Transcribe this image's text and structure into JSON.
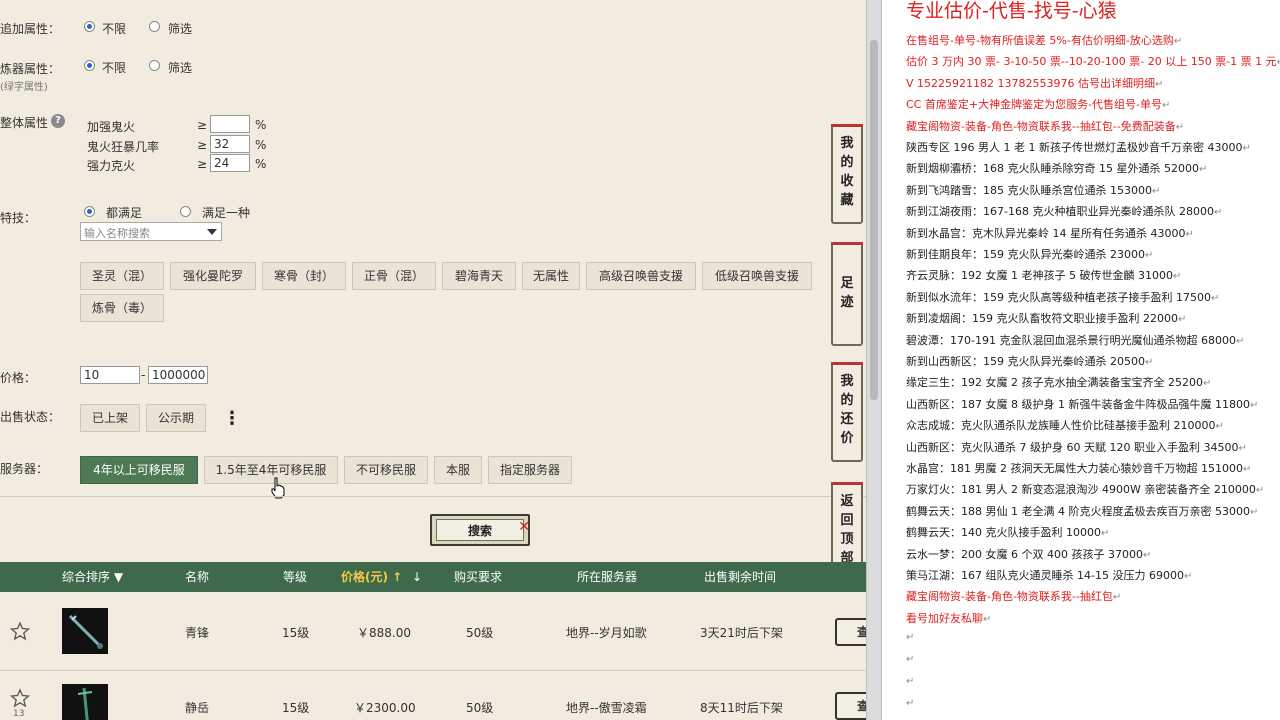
{
  "filters": {
    "extra_attr": {
      "label": "追加属性：",
      "opt1": "不限",
      "opt2": "筛选"
    },
    "forge_attr": {
      "label": "炼器属性：",
      "sub": "(绿字属性)",
      "opt1": "不限",
      "opt2": "筛选"
    },
    "overall": {
      "label": "整体属性",
      "rows": [
        {
          "name": "加强鬼火",
          "op": "≥",
          "value": "",
          "unit": "%"
        },
        {
          "name": "鬼火狂暴几率",
          "op": "≥",
          "value": "32",
          "unit": "%"
        },
        {
          "name": "强力克火",
          "op": "≥",
          "value": "24",
          "unit": "%"
        }
      ]
    },
    "skills": {
      "label": "特技：",
      "opt1": "都满足",
      "opt2": "满足一种",
      "search_placeholder": "输入名称搜索",
      "tags": [
        "圣灵（混）",
        "强化曼陀罗",
        "寒骨（封）",
        "正骨（混）",
        "碧海青天",
        "无属性",
        "高级召唤兽支援",
        "低级召唤兽支援",
        "炼骨（毒）"
      ]
    },
    "price": {
      "label": "价格：",
      "min": "10",
      "sep": "-",
      "max": "1000000"
    },
    "status": {
      "label": "出售状态：",
      "opt1": "已上架",
      "opt2": "公示期",
      "more": "⋮"
    },
    "server": {
      "label": "服务器：",
      "options": [
        "4年以上可移民服",
        "1.5年至4年可移民服",
        "不可移民服",
        "本服",
        "指定服务器"
      ]
    }
  },
  "search_button": "搜索",
  "side_buttons": {
    "fav": "我的收藏",
    "foot": "足迹",
    "bargain": "我的还价",
    "top": "返回顶部"
  },
  "table": {
    "headers": {
      "sort": "综合排序 ▼",
      "name": "名称",
      "level": "等级",
      "price": "价格(元) ↑",
      "price_down": "↓",
      "req": "购买要求",
      "server": "所在服务器",
      "time": "出售剩余时间"
    },
    "rows": [
      {
        "name": "青锋",
        "level": "15级",
        "price": "￥888.00",
        "req": "50级",
        "server": "地界--岁月如歌",
        "time": "3天21时后下架",
        "badge": "",
        "btn": "查"
      },
      {
        "name": "静岳",
        "level": "15级",
        "price": "￥2300.00",
        "req": "50级",
        "server": "地界--傲雪凌霜",
        "time": "8天11时后下架",
        "badge": "13",
        "btn": "查"
      }
    ]
  },
  "notes": {
    "title": "专业估价-代售-找号-心猿",
    "lines": [
      {
        "text": "在售组号-单号-物有所值误差 5%-有估价明细-放心选购",
        "red": true
      },
      {
        "text": "估价 3 万内 30 票- 3-10-50 票--10-20-100 票- 20 以上 150 票-1 票 1 元",
        "red": true
      },
      {
        "text": "V 15225921182    13782553976    估号出详细明细",
        "red": true
      },
      {
        "text": "CC 首席鉴定+大神金牌鉴定为您服务-代售组号-单号",
        "red": true
      },
      {
        "text": "藏宝阁物资-装备-角色-物资联系我--抽红包--免费配装备",
        "red": true
      },
      {
        "text": "陕西专区 196 男人 1 老 1 新孩子传世燃灯孟极妙音千万亲密 43000",
        "red": false
      },
      {
        "text": "新到烟柳灞桥：168 克火队睡杀除穷奇 15 星外通杀 52000",
        "red": false
      },
      {
        "text": "新到飞鸿踏雪：185 克火队睡杀宫位通杀 153000",
        "red": false
      },
      {
        "text": "新到江湖夜雨：167-168 克火种植职业异光秦岭通杀队 28000",
        "red": false
      },
      {
        "text": "新到水晶宫：克木队异光秦岭 14 星所有任务通杀 43000",
        "red": false
      },
      {
        "text": "新到佳期良年：159 克火队异光秦岭通杀 23000",
        "red": false
      },
      {
        "text": "齐云灵脉：192 女魔 1 老神孩子 5 破传世金麟 31000",
        "red": false
      },
      {
        "text": "新到似水流年：159 克火队高等级种植老孩子接手盈利 17500",
        "red": false
      },
      {
        "text": "新到凌烟阁：159 克火队畜牧符文职业接手盈利 22000",
        "red": false
      },
      {
        "text": "碧波潭：170-191 克金队混回血混杀景行明光魔仙通杀物超 68000",
        "red": false
      },
      {
        "text": "新到山西新区：159 克火队异光秦岭通杀 20500",
        "red": false
      },
      {
        "text": "缘定三生：192 女魔 2 孩子克水抽全满装备宝宝齐全 25200",
        "red": false
      },
      {
        "text": "山西新区：187 女魔 8 级护身 1 新强牛装备金牛阵极品强牛魔 11800",
        "red": false
      },
      {
        "text": "众志成城：克火队通杀队龙族睡人性价比硅基接手盈利 210000",
        "red": false
      },
      {
        "text": "山西新区：克火队通杀 7 级护身 60 天赋 120 职业入手盈利 34500",
        "red": false
      },
      {
        "text": "水晶宫：181 男魔 2 孩洞天无属性大力装心猿妙音千万物超 151000",
        "red": false
      },
      {
        "text": "万家灯火：181 男人 2 新变态混浪淘沙 4900W 亲密装备齐全 210000",
        "red": false
      },
      {
        "text": "鹤舞云天：188 男仙 1 老全满 4 阶克火程度孟极去疾百万亲密 53000",
        "red": false
      },
      {
        "text": "鹤舞云天：140 克火队接手盈利 10000",
        "red": false
      },
      {
        "text": "云水一梦：200 女魔 6 个双 400 孩孩子 37000",
        "red": false
      },
      {
        "text": "策马江湖：167 组队克火通灵睡杀 14-15 没压力 69000",
        "red": false
      },
      {
        "text": "藏宝阁物资-装备-角色-物资联系我--抽红包",
        "red": true
      },
      {
        "text": "看号加好友私聊",
        "red": true
      }
    ]
  },
  "colors": {
    "accent_green": "#4d7a54",
    "header_green": "#3e6a4b",
    "note_red": "#e02020"
  }
}
